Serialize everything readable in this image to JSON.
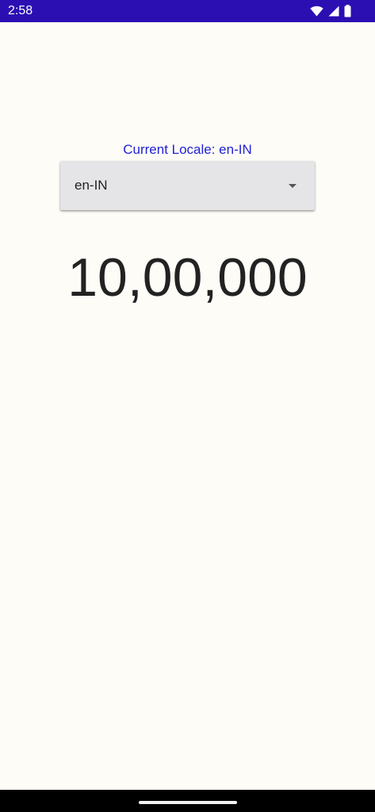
{
  "status_bar": {
    "time": "2:58",
    "icons": [
      "wifi-icon",
      "cellular-signal-icon",
      "battery-icon"
    ],
    "background_color": "#2b0fb2"
  },
  "main": {
    "locale_label": "Current Locale: en-IN",
    "locale_label_color": "#2222d6",
    "locale_spinner": {
      "selected_value": "en-IN",
      "icon": "dropdown-arrow-icon"
    },
    "number_display": "10,00,000"
  },
  "colors": {
    "page_background": "#fdfcf7",
    "spinner_background": "#e5e4e6",
    "nav_bar": "#000000"
  }
}
